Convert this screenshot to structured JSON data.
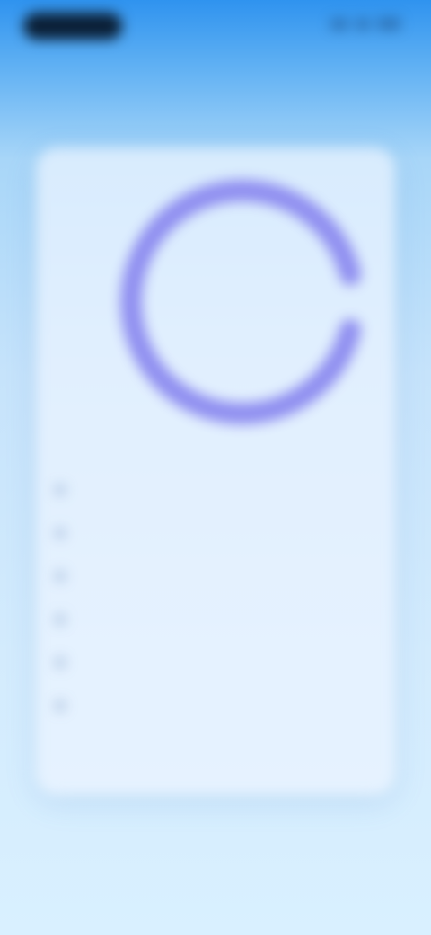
{
  "status_bar": {
    "time": "",
    "icons": [
      "signal-icon",
      "wifi-icon",
      "battery-icon"
    ]
  },
  "progress": {
    "fraction": 0.92,
    "color": "#8f8ef0",
    "label": ""
  },
  "list": {
    "items": [
      {
        "text": ""
      },
      {
        "text": ""
      },
      {
        "text": ""
      },
      {
        "text": ""
      },
      {
        "text": ""
      },
      {
        "text": ""
      }
    ]
  },
  "colors": {
    "background_top": "#2f93ef",
    "background_bottom": "#d9f0ff",
    "card": "#ebf4ff",
    "ring": "#8f8ef0"
  }
}
